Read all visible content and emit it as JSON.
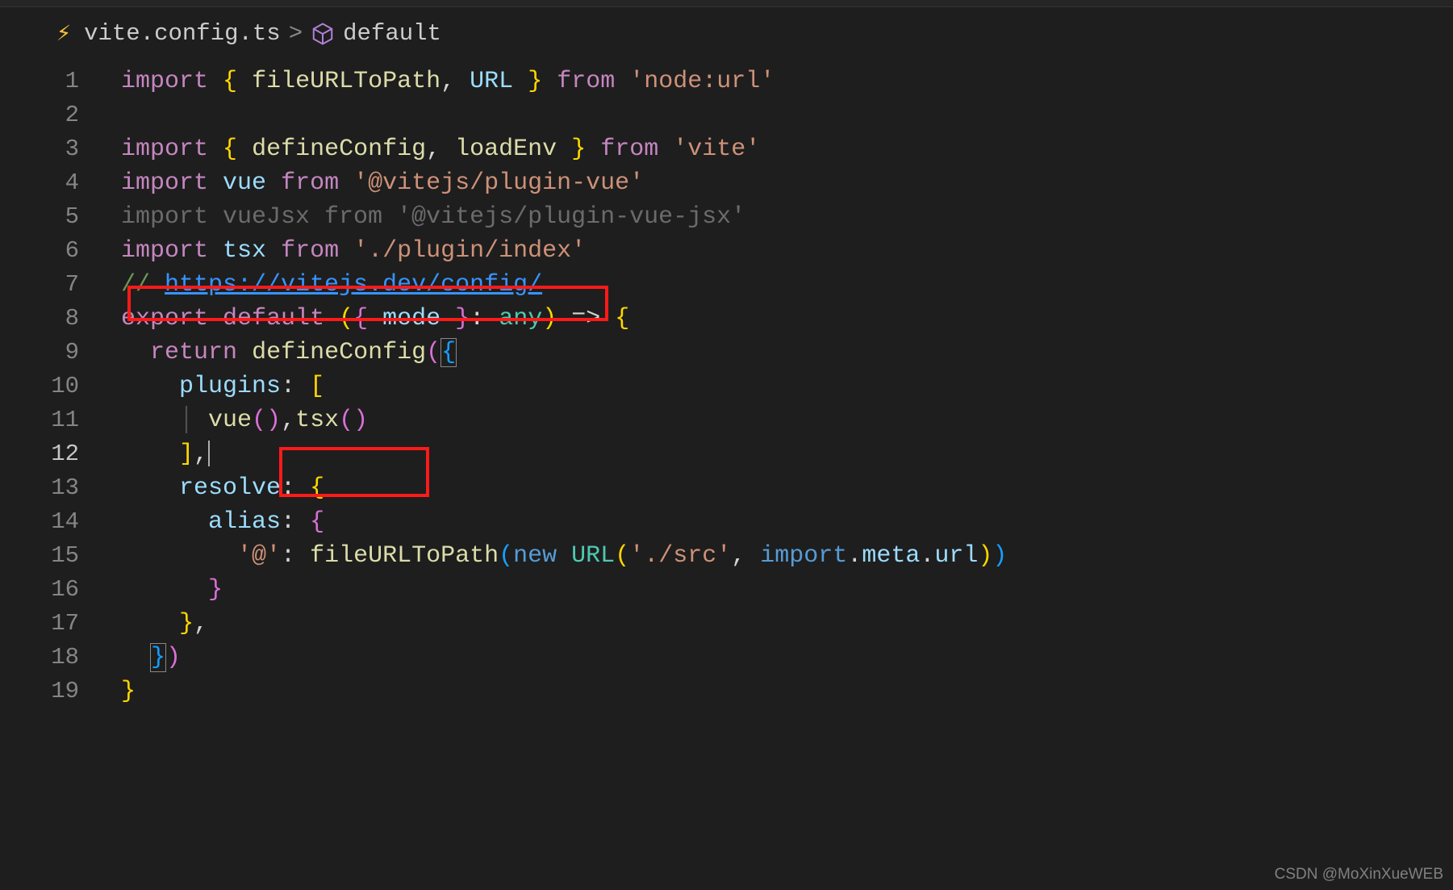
{
  "breadcrumb": {
    "file": "vite.config.ts",
    "separator": ">",
    "symbol": "default"
  },
  "watermark": "CSDN @MoXinXueWEB",
  "code": {
    "l1": {
      "kw1": "import",
      "br_o": "{",
      "id1": "fileURLToPath",
      "comma": ",",
      "id2": "URL",
      "br_c": "}",
      "kw2": "from",
      "str": "'node:url'"
    },
    "l3": {
      "kw1": "import",
      "br_o": "{",
      "id1": "defineConfig",
      "comma": ",",
      "id2": "loadEnv",
      "br_c": "}",
      "kw2": "from",
      "str": "'vite'"
    },
    "l4": {
      "kw1": "import",
      "id": "vue",
      "kw2": "from",
      "str": "'@vitejs/plugin-vue'"
    },
    "l5": {
      "txt": "import vueJsx from '@vitejs/plugin-vue-jsx'"
    },
    "l6": {
      "kw1": "import",
      "id": "tsx",
      "kw2": "from",
      "str": "'./plugin/index'"
    },
    "l7": {
      "cmt": "// ",
      "link": "https://vitejs.dev/config/"
    },
    "l8": {
      "kw1": "export",
      "kw2": "default",
      "p_o": "(",
      "br_o": "{",
      "id": "mode",
      "br_c": "}",
      "colon": ":",
      "type": "any",
      "p_c": ")",
      "arrow": "=>",
      "cb_o": "{"
    },
    "l9": {
      "kw": "return",
      "fn": "defineConfig",
      "p_o": "(",
      "cb_o": "{"
    },
    "l10": {
      "key": "plugins",
      "colon": ":",
      "br_o": "["
    },
    "l11": {
      "fn1": "vue",
      "p1o": "(",
      "p1c": ")",
      "comma": ",",
      "fn2": "tsx",
      "p2o": "(",
      "p2c": ")"
    },
    "l12": {
      "br_c": "]",
      "comma": ","
    },
    "l13": {
      "key": "resolve",
      "colon": ":",
      "cb_o": "{"
    },
    "l14": {
      "key": "alias",
      "colon": ":",
      "cb_o": "{"
    },
    "l15": {
      "str1": "'@'",
      "colon": ":",
      "fn": "fileURLToPath",
      "p_o": "(",
      "kw": "new",
      "cls": "URL",
      "p2o": "(",
      "str2": "'./src'",
      "comma": ",",
      "imp": "import",
      "dot1": ".",
      "meta": "meta",
      "dot2": ".",
      "url": "url",
      "p2c": ")",
      "p_c": ")"
    },
    "l16": {
      "cb_c": "}"
    },
    "l17": {
      "cb_c": "}",
      "comma": ","
    },
    "l18": {
      "cb_c": "}",
      "p_c": ")"
    },
    "l19": {
      "cb_c": "}"
    }
  },
  "line_numbers": [
    "1",
    "2",
    "3",
    "4",
    "5",
    "6",
    "7",
    "8",
    "9",
    "10",
    "11",
    "12",
    "13",
    "14",
    "15",
    "16",
    "17",
    "18",
    "19"
  ]
}
